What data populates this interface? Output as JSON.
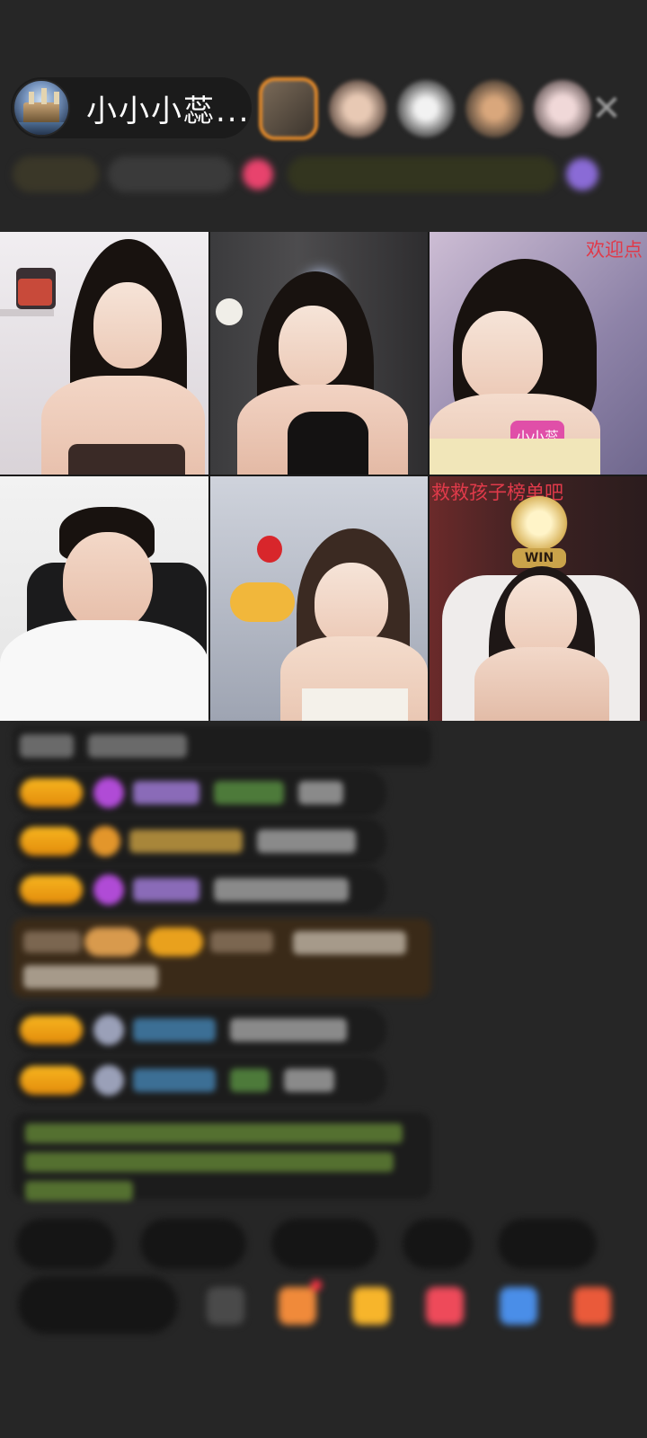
{
  "header": {
    "host_name": "小小小蕊...",
    "close_icon": "close-icon"
  },
  "info_row": {
    "chips": [
      "",
      "",
      "",
      ""
    ]
  },
  "tiles": [
    {
      "name": "guest-1",
      "overlay": ""
    },
    {
      "name": "guest-2",
      "overlay": ""
    },
    {
      "name": "guest-3",
      "overlay": "欢迎点",
      "sticker": "小小蕊"
    },
    {
      "name": "guest-4",
      "overlay": ""
    },
    {
      "name": "guest-5",
      "overlay": ""
    },
    {
      "name": "guest-6",
      "overlay": "救救孩子榜单吧",
      "badge": "WIN"
    }
  ],
  "chat": {
    "messages": [
      "",
      "",
      "",
      "",
      "",
      "",
      "",
      ""
    ]
  },
  "quick_replies": [
    "",
    "",
    "",
    "",
    ""
  ],
  "bottom_bar": {
    "input_placeholder": ""
  },
  "colors": {
    "background": "#262626",
    "badge_orange": "#f0a11a",
    "viewer_frame": "#e58b2b",
    "overlay_red": "#e03a4a"
  }
}
